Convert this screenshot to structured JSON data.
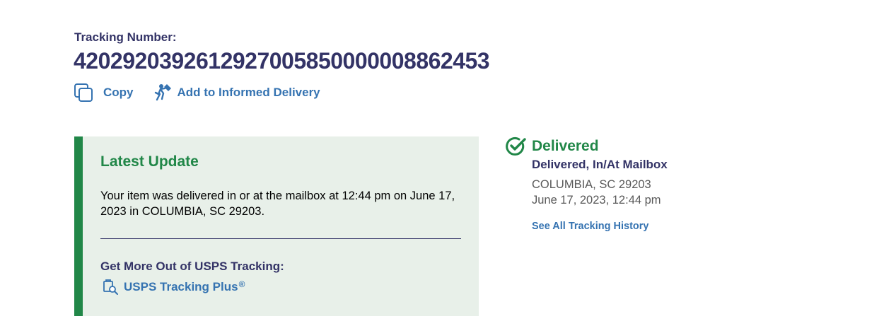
{
  "tracking": {
    "label": "Tracking Number:",
    "number": "4202920392612927005850000008862453"
  },
  "actions": {
    "copy": "Copy",
    "informed": "Add to Informed Delivery"
  },
  "latest": {
    "title": "Latest Update",
    "text": "Your item was delivered in or at the mailbox at 12:44 pm on June 17, 2023 in COLUMBIA, SC 29203.",
    "more_title": "Get More Out of USPS Tracking:",
    "plus_label": "USPS Tracking Plus",
    "plus_mark": "®"
  },
  "status": {
    "title": "Delivered",
    "detail": "Delivered, In/At Mailbox",
    "location": "COLUMBIA, SC 29203",
    "date": "June 17, 2023, 12:44 pm",
    "history_link": "See All Tracking History"
  },
  "colors": {
    "navy": "#333366",
    "link_blue": "#3573b1",
    "success_green": "#218748",
    "panel_bg": "#e8f0e9"
  },
  "icons": [
    "copy-icon",
    "mail-carrier-icon",
    "package-search-icon",
    "check-circle-icon"
  ]
}
